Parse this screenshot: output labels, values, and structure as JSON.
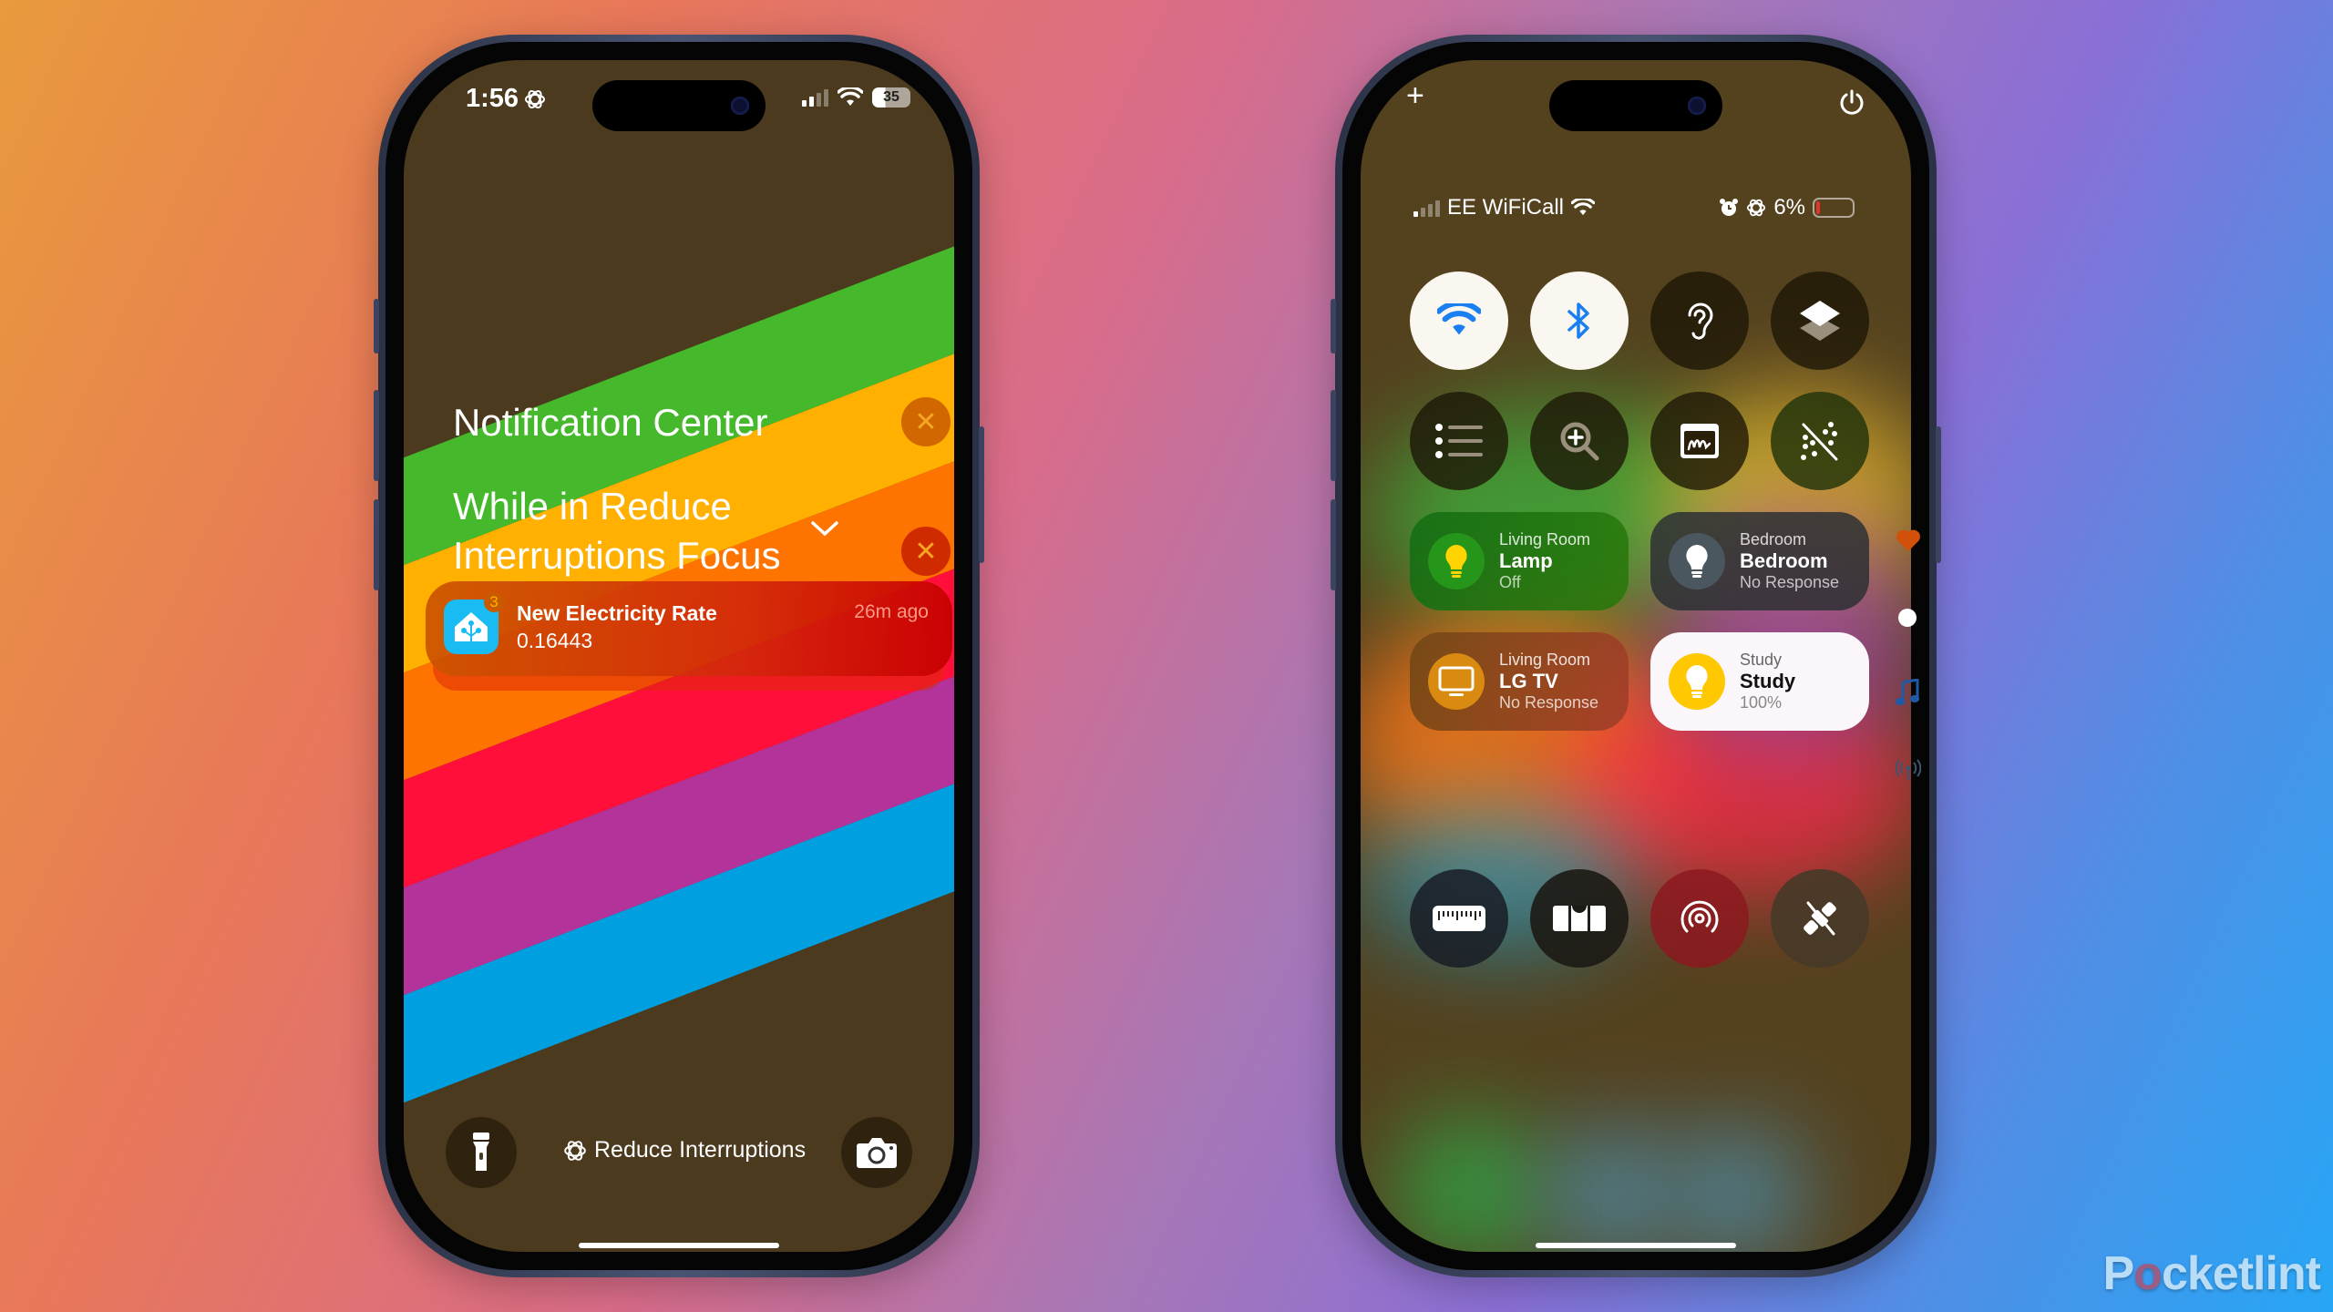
{
  "left_phone": {
    "status_bar": {
      "time": "1:56",
      "focus_icon": "reduce-interruptions-icon",
      "signal_bars_active": 2,
      "signal_bars_total": 4,
      "battery_percent": "35"
    },
    "wallpaper_stripes": [
      "#45b82c",
      "#ffb000",
      "#ff7300",
      "#ff0f3a",
      "#b3339b",
      "#00a0e0"
    ],
    "notification_center": {
      "title": "Notification Center",
      "group_title": "While in Reduce Interruptions Focus",
      "notification": {
        "app_icon": "home-assistant-icon",
        "badge_count": "3",
        "title": "New Electricity Rate",
        "body": "0.16443",
        "time": "26m ago"
      }
    },
    "bottom": {
      "focus_label": "Reduce Interruptions",
      "left_button": "flashlight-icon",
      "right_button": "camera-icon"
    }
  },
  "right_phone": {
    "top": {
      "add_icon": "+",
      "power_icon": "power-icon"
    },
    "status_bar": {
      "carrier": "EE WiFiCall",
      "battery_percent": "6%",
      "signal_bars_active": 1,
      "signal_bars_total": 4
    },
    "toggles_row1": [
      {
        "name": "wifi",
        "state": "on"
      },
      {
        "name": "bluetooth",
        "state": "on"
      },
      {
        "name": "hearing",
        "state": "off"
      },
      {
        "name": "shortcuts",
        "state": "off"
      }
    ],
    "toggles_row2": [
      {
        "name": "list",
        "state": "off"
      },
      {
        "name": "magnifier",
        "state": "off"
      },
      {
        "name": "signature",
        "state": "off"
      },
      {
        "name": "background-sounds-off",
        "state": "off"
      }
    ],
    "home_tiles": [
      {
        "room": "Living Room",
        "name": "Lamp",
        "state": "Off",
        "icon": "lightbulb"
      },
      {
        "room": "Bedroom",
        "name": "Bedroom",
        "state": "No Response",
        "icon": "lightbulb"
      },
      {
        "room": "Living Room",
        "name": "LG TV",
        "state": "No Response",
        "icon": "tv"
      },
      {
        "room": "Study",
        "name": "Study",
        "state": "100%",
        "icon": "lightbulb"
      }
    ],
    "toggles_row3": [
      {
        "name": "measure"
      },
      {
        "name": "level"
      },
      {
        "name": "airdrop",
        "state": "on"
      },
      {
        "name": "satellite-off"
      }
    ],
    "page_indicators": [
      "favorites",
      "current-page",
      "music",
      "connectivity"
    ]
  },
  "watermark": {
    "prefix": "P",
    "o": "o",
    "suffix": "cketlint"
  }
}
